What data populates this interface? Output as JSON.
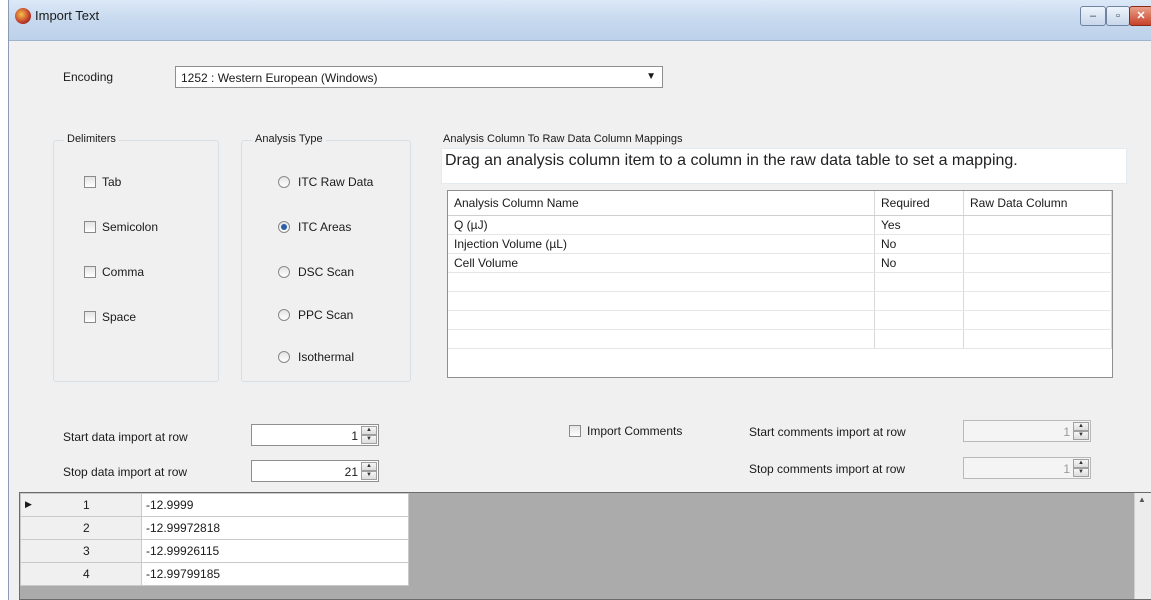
{
  "window": {
    "title": "Import Text",
    "min_glyph": "–",
    "max_glyph": "▫",
    "close_glyph": "✕"
  },
  "encoding": {
    "label": "Encoding",
    "value": "1252 : Western European (Windows)"
  },
  "delimiters": {
    "title": "Delimiters",
    "items": [
      {
        "label": "Tab",
        "checked": false
      },
      {
        "label": "Semicolon",
        "checked": false
      },
      {
        "label": "Comma",
        "checked": false
      },
      {
        "label": "Space",
        "checked": false
      }
    ]
  },
  "analysis_type": {
    "title": "Analysis Type",
    "items": [
      {
        "label": "ITC Raw Data",
        "selected": false
      },
      {
        "label": "ITC Areas",
        "selected": true
      },
      {
        "label": "DSC Scan",
        "selected": false
      },
      {
        "label": "PPC Scan",
        "selected": false
      },
      {
        "label": "Isothermal",
        "selected": false
      }
    ]
  },
  "mappings": {
    "title": "Analysis Column To Raw Data Column Mappings",
    "hint": "Drag an analysis column item to a column in the raw data table to set a mapping.",
    "columns": [
      "Analysis Column Name",
      "Required",
      "Raw Data Column"
    ],
    "rows": [
      [
        "Q (µJ)",
        "Yes",
        ""
      ],
      [
        "Injection Volume (µL)",
        "No",
        ""
      ],
      [
        "Cell Volume",
        "No",
        ""
      ]
    ]
  },
  "import_rows": {
    "start_label": "Start data import at row",
    "start_value": "1",
    "stop_label": "Stop data import at row",
    "stop_value": "21"
  },
  "comments": {
    "checkbox_label": "Import Comments",
    "start_label": "Start comments import at row",
    "start_value": "1",
    "stop_label": "Stop comments import at row",
    "stop_value": "1"
  },
  "data_grid": {
    "rows": [
      {
        "num": "1",
        "value": "-12.9999"
      },
      {
        "num": "2",
        "value": "-12.99972818"
      },
      {
        "num": "3",
        "value": "-12.99926115"
      },
      {
        "num": "4",
        "value": "-12.99799185"
      }
    ]
  },
  "icons": {
    "app": "app-logo-icon",
    "dropdown": "chevron-down-icon",
    "spin_up": "spin-up-icon",
    "spin_down": "spin-down-icon"
  }
}
